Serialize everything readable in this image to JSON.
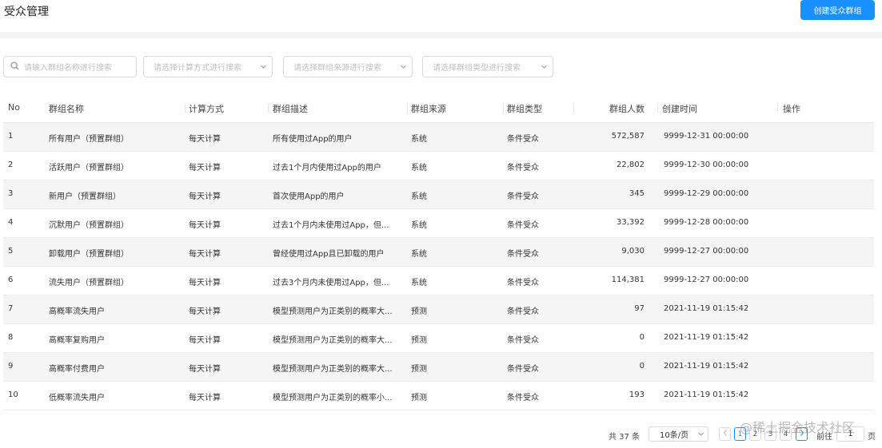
{
  "header": {
    "title": "受众管理",
    "create_button": "创建受众群组"
  },
  "filters": {
    "search_placeholder": "请输入群组名称进行搜索",
    "calc_placeholder": "请选择计算方式进行搜索",
    "source_placeholder": "请选择群组来源进行搜索",
    "type_placeholder": "请选择群组类型进行搜索"
  },
  "table": {
    "columns": [
      "No",
      "群组名称",
      "计算方式",
      "群组描述",
      "群组来源",
      "群组类型",
      "群组人数",
      "创建时间",
      "操作"
    ],
    "rows": [
      {
        "no": "1",
        "name": "所有用户（预置群组）",
        "calc": "每天计算",
        "desc": "所有使用过App的用户",
        "source": "系统",
        "type": "条件受众",
        "count": "572,587",
        "created": "9999-12-31 00:00:00"
      },
      {
        "no": "2",
        "name": "活跃用户（预置群组）",
        "calc": "每天计算",
        "desc": "过去1个月内使用过App的用户",
        "source": "系统",
        "type": "条件受众",
        "count": "22,802",
        "created": "9999-12-30 00:00:00"
      },
      {
        "no": "3",
        "name": "新用户（预置群组）",
        "calc": "每天计算",
        "desc": "首次使用App的用户",
        "source": "系统",
        "type": "条件受众",
        "count": "345",
        "created": "9999-12-29 00:00:00"
      },
      {
        "no": "4",
        "name": "沉默用户（预置群组）",
        "calc": "每天计算",
        "desc": "过去1个月内未使用过App，但...",
        "source": "系统",
        "type": "条件受众",
        "count": "33,392",
        "created": "9999-12-28 00:00:00"
      },
      {
        "no": "5",
        "name": "卸载用户（预置群组）",
        "calc": "每天计算",
        "desc": "曾经使用过App且已卸载的用户",
        "source": "系统",
        "type": "条件受众",
        "count": "9,030",
        "created": "9999-12-27 00:00:00"
      },
      {
        "no": "6",
        "name": "流失用户（预置群组）",
        "calc": "每天计算",
        "desc": "过去3个月内未使用过App，但...",
        "source": "系统",
        "type": "条件受众",
        "count": "114,381",
        "created": "9999-12-27 00:00:00"
      },
      {
        "no": "7",
        "name": "高概率流失用户",
        "calc": "每天计算",
        "desc": "模型预测用户为正类别的概率大...",
        "source": "预测",
        "type": "条件受众",
        "count": "97",
        "created": "2021-11-19 01:15:42"
      },
      {
        "no": "8",
        "name": "高概率复购用户",
        "calc": "每天计算",
        "desc": "模型预测用户为正类别的概率大...",
        "source": "预测",
        "type": "条件受众",
        "count": "0",
        "created": "2021-11-19 01:15:42"
      },
      {
        "no": "9",
        "name": "高概率付费用户",
        "calc": "每天计算",
        "desc": "模型预测用户为正类别的概率大...",
        "source": "预测",
        "type": "条件受众",
        "count": "0",
        "created": "2021-11-19 01:15:42"
      },
      {
        "no": "10",
        "name": "低概率流失用户",
        "calc": "每天计算",
        "desc": "模型预测用户为正类别的概率小...",
        "source": "预测",
        "type": "条件受众",
        "count": "193",
        "created": "2021-11-19 01:15:42"
      }
    ]
  },
  "pagination": {
    "total": "共 37 条",
    "page_size": "10条/页",
    "pages": [
      "1",
      "2",
      "3",
      "4"
    ],
    "current": "1",
    "goto_label": "前往",
    "goto_value": "1",
    "suffix": "页"
  },
  "watermark": "@稀土掘金技术社区",
  "colors": {
    "primary": "#1890ff",
    "row_stripe": "#f5f5f5"
  }
}
